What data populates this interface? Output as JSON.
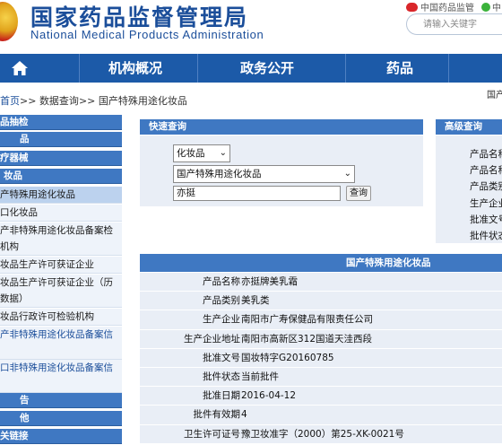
{
  "header": {
    "title_cn": "国家药品监督管理局",
    "title_en": "National Medical Products Administration",
    "weibo": "中国药品监管",
    "weibo2": "中",
    "search_placeholder": "请输入关键字"
  },
  "nav": {
    "items": [
      "机构概况",
      "政务公开",
      "药品"
    ]
  },
  "breadcrumb": {
    "home": "首页",
    "sep1": ">>",
    "data_query": "数据查询",
    "sep2": ">>",
    "current": "国产特殊用途化妆品",
    "right": "国产"
  },
  "sidebar": {
    "items": [
      {
        "label": "品抽检",
        "kind": "cat"
      },
      {
        "label": "品",
        "kind": "cat"
      },
      {
        "label": "疗器械",
        "kind": "cat"
      },
      {
        "label": "妆品",
        "kind": "cat"
      },
      {
        "label": "产特殊用途化妆品",
        "kind": "sub"
      },
      {
        "label": "口化妆品",
        "kind": "sub"
      },
      {
        "label": "产非特殊用途化妆品备案检机构",
        "kind": "sub"
      },
      {
        "label": "妆品生产许可获证企业",
        "kind": "sub"
      },
      {
        "label": "妆品生产许可获证企业（历数据）",
        "kind": "sub"
      },
      {
        "label": "妆品行政许可检验机构",
        "kind": "sub"
      },
      {
        "label": "产非特殊用途化妆品备案信",
        "kind": "sub"
      },
      {
        "label": "口非特殊用途化妆品备案信",
        "kind": "sub"
      },
      {
        "label": "告",
        "kind": "cat"
      },
      {
        "label": "他",
        "kind": "cat"
      },
      {
        "label": "关链接",
        "kind": "cat"
      }
    ]
  },
  "quick_search": {
    "title": "快速查询",
    "category": "化妆品",
    "subcategory": "国产特殊用途化妆品",
    "keyword": "亦挺",
    "button": "查询"
  },
  "advanced_search": {
    "title": "高级查询",
    "fields": [
      "产品名称",
      "产品名称",
      "产品类别",
      "生产企业",
      "批准文号",
      "批件状态"
    ]
  },
  "result": {
    "title": "国产特殊用途化妆品",
    "rows": [
      {
        "label": "产品名称",
        "value": "亦挺牌美乳霜"
      },
      {
        "label": "产品类别",
        "value": "美乳类"
      },
      {
        "label": "生产企业",
        "value": "南阳市广寿保健品有限责任公司"
      },
      {
        "label": "生产企业地址",
        "value": "南阳市高新区312国道天洼西段"
      },
      {
        "label": "批准文号",
        "value": "国妆特字G20160785"
      },
      {
        "label": "批件状态",
        "value": "当前批件"
      },
      {
        "label": "批准日期",
        "value": "2016-04-12"
      },
      {
        "label": "批件有效期",
        "value": "4"
      },
      {
        "label": "卫生许可证号",
        "value": "豫卫妆准字（2000）第25-XK-0021号"
      }
    ]
  },
  "colors": {
    "brand_blue": "#1b4e9a",
    "nav_blue": "#1c5aa8",
    "panel_blue": "#3f78c2",
    "panel_bg": "#e9eef6"
  }
}
